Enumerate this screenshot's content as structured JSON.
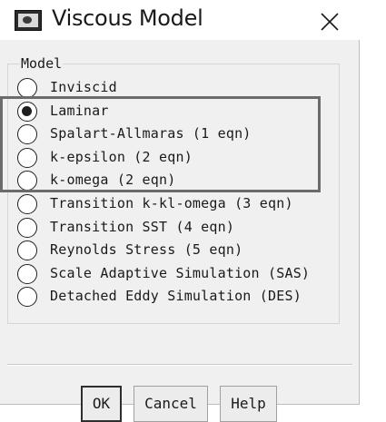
{
  "window": {
    "title": "Viscous Model"
  },
  "group": {
    "label": "Model",
    "selected_index": 1,
    "options": [
      {
        "label": "Inviscid"
      },
      {
        "label": "Laminar"
      },
      {
        "label": "Spalart-Allmaras (1 eqn)"
      },
      {
        "label": "k-epsilon (2 eqn)"
      },
      {
        "label": "k-omega (2 eqn)"
      },
      {
        "label": "Transition k-kl-omega (3 eqn)"
      },
      {
        "label": "Transition SST (4 eqn)"
      },
      {
        "label": "Reynolds Stress (5 eqn)"
      },
      {
        "label": "Scale Adaptive Simulation (SAS)"
      },
      {
        "label": "Detached Eddy Simulation (DES)"
      }
    ]
  },
  "buttons": {
    "ok_label": "OK",
    "cancel_label": "Cancel",
    "help_label": "Help"
  },
  "icons": {
    "app": "fluent-app-icon",
    "close": "close-icon"
  },
  "colors": {
    "client_bg": "#f0f0f0",
    "highlight_border": "#6b6b6b",
    "text": "#1a1a1a"
  }
}
